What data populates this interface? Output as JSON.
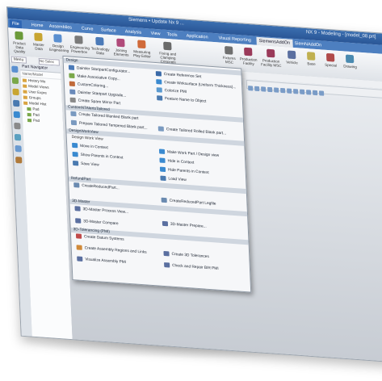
{
  "title_text": "Siemens • Update Nx 9 ...",
  "title_right": "NX 9 - Modeling - [model_08.prt]",
  "tabs": [
    "File",
    "Home",
    "Assemblies",
    "Curve",
    "Surface",
    "Analysis",
    "View",
    "Tools",
    "Application",
    "Visual Reporting",
    "SiemensAddOn",
    "SiemNAddOn"
  ],
  "ribbon": [
    "Product Data Quality",
    "Master Data",
    "Design Engineering",
    "Engineering Powerbox",
    "Technology Data",
    "Joining Elements",
    "Measuring Play Editor",
    "Fixing and Clamping Concepts",
    "Fixtures MSC",
    "Production Facility",
    "Production Facility MSC",
    "Vehicle",
    "Base",
    "Special",
    "Drawing"
  ],
  "menu_label": "Menu",
  "selection_filter": "No Selec",
  "navigator": {
    "title": "Part Navigator",
    "name_col": "Name/Model",
    "rows": [
      "History Mo",
      "Model Views",
      "User Expre",
      "Groups",
      "Model Hist",
      "Pad",
      "Pad",
      "Pad"
    ]
  },
  "dropdown": {
    "sections": [
      "Design",
      "CustomNTAlertsTailored",
      "Design Work View",
      "RefundPart",
      "3D-Master",
      "3D-Tolerancing (PMI)"
    ],
    "items_left": [
      "Daimler StartpartConfigurator...",
      "Make Associative Copy...",
      "CustomColoring...",
      "Daimler Startpart Upgrade...",
      "Create Spare Mirror Part",
      "Create Tailored Blanked Blank part",
      "Prepare Tailored Tempered Blank part...",
      "DesignWorkView",
      "Move in Context",
      "Show Parents in Context",
      "Save View",
      "CreateReducedPart...",
      "3D-Master Process View...",
      "3D-Master Compare",
      "Create Datum Systems",
      "Create Assembly Regions and Links",
      "Visualize Assembly PMI"
    ],
    "items_right": [
      "Create Reference Set",
      "Create Wirksurface (Uniform Thickness)...",
      "Colorize PMI",
      "Feature Name to Object",
      "Create Tailored Rolled Blank part...",
      "Make Work Part / Design view",
      "Hide in Context",
      "Hide Parents in Context",
      "Load View",
      "CreateReducedPart Legfile",
      "3D-Master Prepare...",
      "Create 3D Tolerances",
      "Check and Repair BIR PMI"
    ]
  },
  "colors": {
    "accent": "#3b6fb0",
    "tab_bar": "#4d7fc0",
    "menu_bg": "#f6f7f9",
    "section_bg": "#cfd6df"
  }
}
